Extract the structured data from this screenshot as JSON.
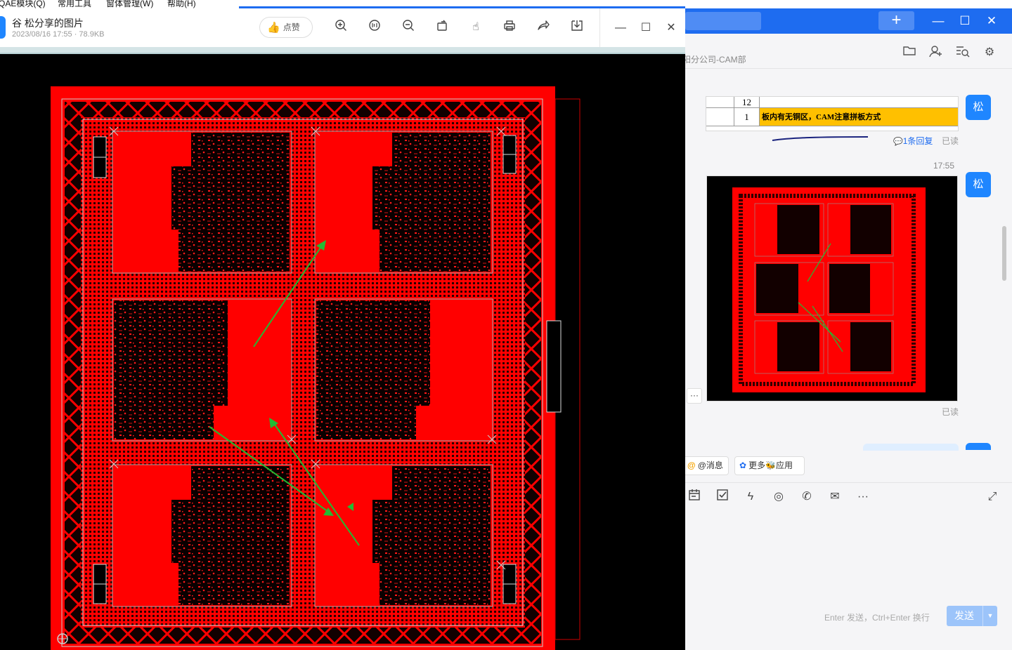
{
  "menubar": {
    "items": [
      "QAE模块(Q)",
      "常用工具",
      "窗体管理(W)",
      "帮助(H)"
    ]
  },
  "viewer": {
    "title": "谷  松分享的图片",
    "meta": "2023/08/16 17:55 · 78.9KB",
    "like_label": "点赞",
    "toolbar_icons": [
      "zoom-in-icon",
      "fit-icon",
      "zoom-out-icon",
      "rotate-icon",
      "pan-hand-icon",
      "print-icon",
      "share-icon",
      "download-icon"
    ],
    "window_controls": [
      "minimize-icon",
      "maximize-icon",
      "close-icon"
    ],
    "image": {
      "description_colors": {
        "board": "#ff0000",
        "background": "#000000",
        "arrows": "#22bb33"
      }
    }
  },
  "chat": {
    "subtitle": "阳分公司-CAM部",
    "avatar_label": "松",
    "snippet": {
      "row1_num": "12",
      "row2_num": "1",
      "row2_text": "板内有无铜区，CAM注意拼板方式"
    },
    "reply_link": "1条回复",
    "read_label": "已读",
    "time": "17:55",
    "more_label": "···",
    "chips": [
      {
        "icon": "@",
        "label": "@消息"
      },
      {
        "icon": "✿",
        "label": "更多🐝应用"
      }
    ],
    "send": {
      "hint": "Enter 发送，Ctrl+Enter 换行",
      "label": "发送",
      "dropdown": "▼"
    },
    "colors": {
      "accent": "#1e6cf0",
      "avatar": "#1f86ff"
    }
  }
}
